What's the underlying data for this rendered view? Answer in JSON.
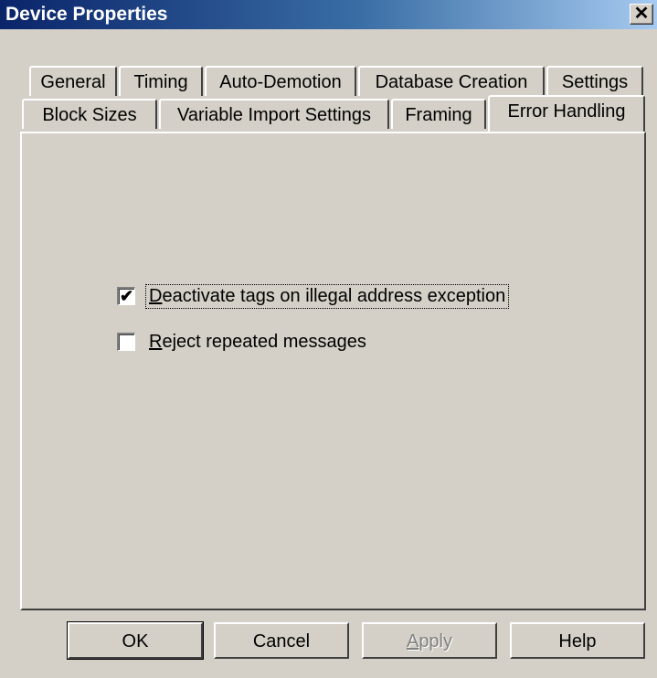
{
  "window": {
    "title": "Device Properties",
    "close_glyph": "✕"
  },
  "tabs": {
    "row1": [
      "General",
      "Timing",
      "Auto-Demotion",
      "Database Creation",
      "Settings"
    ],
    "row2": [
      "Block Sizes",
      "Variable Import Settings",
      "Framing",
      "Error Handling"
    ],
    "active": "Error Handling"
  },
  "options": {
    "deactivate_tags": {
      "label_accel": "D",
      "label_rest": "eactivate tags on illegal address exception",
      "checked": true,
      "check_glyph": "✔"
    },
    "reject_repeated": {
      "label_accel": "R",
      "label_rest": "eject repeated messages",
      "checked": false,
      "check_glyph": ""
    }
  },
  "buttons": {
    "ok": "OK",
    "cancel": "Cancel",
    "apply_accel": "A",
    "apply_rest": "pply",
    "help": "Help"
  },
  "colors": {
    "face": "#d4d0c8",
    "title_start": "#0a246a",
    "title_end": "#a6caf0"
  }
}
